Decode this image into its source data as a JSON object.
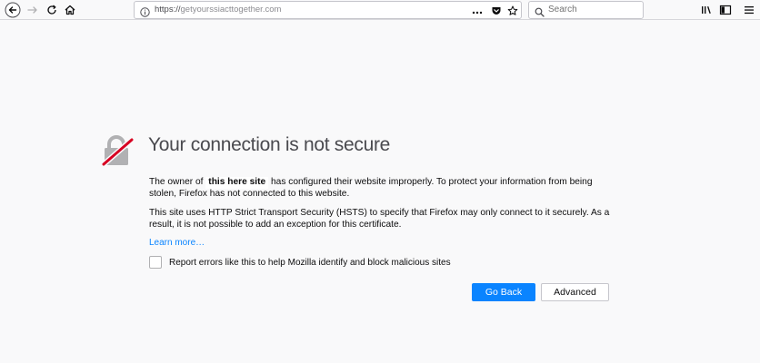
{
  "toolbar": {
    "back_icon": "back-arrow-icon",
    "forward_icon": "forward-arrow-icon",
    "reload_icon": "reload-icon",
    "home_icon": "home-icon",
    "url": {
      "protocol": "https://",
      "host": "getyourssiacttogether.com",
      "info_icon": "info-icon",
      "actions_icon": "page-actions-icon",
      "pocket_icon": "pocket-icon",
      "bookmark_icon": "star-icon"
    },
    "search": {
      "placeholder": "Search",
      "icon": "search-icon"
    },
    "library_icon": "library-icon",
    "sidebar_icon": "sidebar-icon",
    "menu_icon": "hamburger-menu-icon"
  },
  "error": {
    "icon": "broken-lock-icon",
    "title": "Your connection is not secure",
    "para1_before": "The owner of ",
    "para1_redacted": "this here site",
    "para1_after": " has configured their website improperly. To protect your information from being stolen, Firefox has not connected to this website.",
    "para2": "This site uses HTTP Strict Transport Security (HSTS) to specify that Firefox may only connect to it securely. As a result, it is not possible to add an exception for this certificate.",
    "learn_more": "Learn more…",
    "checkbox_label": "Report errors like this to help Mozilla identify and block malicious sites",
    "checkbox_checked": false,
    "go_back": "Go Back",
    "advanced": "Advanced"
  },
  "colors": {
    "accent": "#0a84ff",
    "background": "#f9f9fa",
    "icon_strike": "#d70022"
  }
}
